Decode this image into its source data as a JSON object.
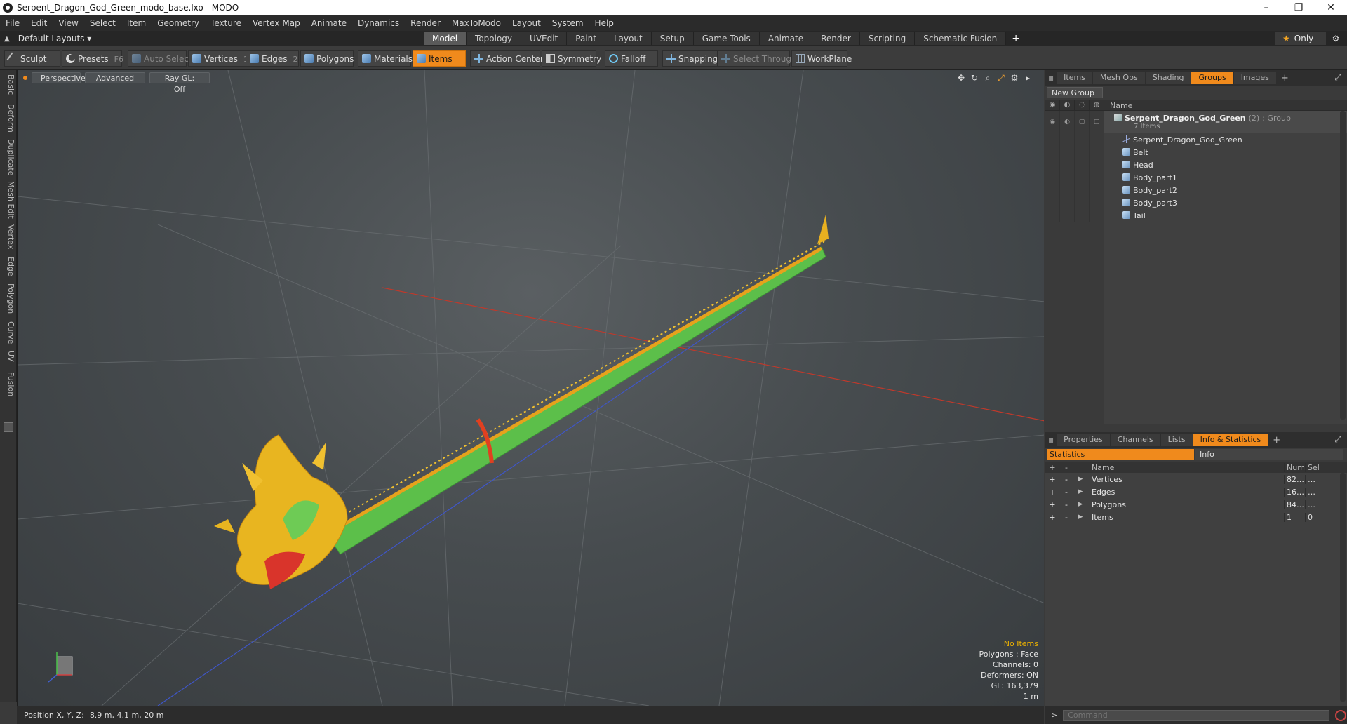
{
  "window": {
    "title": "Serpent_Dragon_God_Green_modo_base.lxo - MODO",
    "minimize": "–",
    "maximize": "❐",
    "close": "✕"
  },
  "menu": [
    "File",
    "Edit",
    "View",
    "Select",
    "Item",
    "Geometry",
    "Texture",
    "Vertex Map",
    "Animate",
    "Dynamics",
    "Render",
    "MaxToModo",
    "Layout",
    "System",
    "Help"
  ],
  "layout_bar": {
    "layout_label": "Default Layouts ▾",
    "tabs": [
      "Model",
      "Topology",
      "UVEdit",
      "Paint",
      "Layout",
      "Setup",
      "Game Tools",
      "Animate",
      "Render",
      "Scripting",
      "Schematic Fusion"
    ],
    "active_tab": "Model",
    "add": "+",
    "only": "Only"
  },
  "toolbar": {
    "sculpt": "Sculpt",
    "presets": "Presets",
    "presets_key": "F6",
    "auto_select": "Auto Select",
    "vertices": "Vertices",
    "vertices_count": "1",
    "edges": "Edges",
    "edges_count": "2",
    "polygons": "Polygons",
    "materials": "Materials",
    "items": "Items",
    "action_center": "Action Center",
    "symmetry": "Symmetry",
    "falloff": "Falloff",
    "snapping": "Snapping",
    "select_through": "Select Through",
    "workplane": "WorkPlane"
  },
  "left_tabs": [
    "Basic",
    "Deform",
    "Duplicate",
    "Mesh Edit",
    "Vertex",
    "Edge",
    "Polygon",
    "Curve",
    "UV",
    "Fusion"
  ],
  "viewport": {
    "perspective": "Perspective",
    "advanced": "Advanced",
    "raygl": "Ray GL: Off",
    "info": {
      "no_items": "No Items",
      "polygons": "Polygons : Face",
      "channels": "Channels: 0",
      "deformers": "Deformers: ON",
      "gl": "GL: 163,379",
      "scale": "1 m"
    }
  },
  "status": {
    "label": "Position X, Y, Z:",
    "value": "8.9 m, 4.1 m, 20 m"
  },
  "groups_panel": {
    "tabs": [
      "Items",
      "Mesh Ops",
      "Shading",
      "Groups",
      "Images"
    ],
    "active_tab": "Groups",
    "new_group": "New Group",
    "name_header": "Name",
    "group": {
      "name": "Serpent_Dragon_God_Green",
      "count": "(2)",
      "type": ": Group",
      "items_note": "7 Items"
    },
    "children": [
      "Serpent_Dragon_God_Green",
      "Belt",
      "Head",
      "Body_part1",
      "Body_part2",
      "Body_part3",
      "Tail"
    ]
  },
  "stats_panel": {
    "tabs": [
      "Properties",
      "Channels",
      "Lists",
      "Info & Statistics"
    ],
    "active_tab": "Info & Statistics",
    "sub_tabs": [
      "Statistics",
      "Info"
    ],
    "headers": {
      "name": "Name",
      "num": "Num",
      "sel": "Sel"
    },
    "rows": [
      {
        "name": "Vertices",
        "num": "82…",
        "sel": "…"
      },
      {
        "name": "Edges",
        "num": "16…",
        "sel": "…"
      },
      {
        "name": "Polygons",
        "num": "84…",
        "sel": "…"
      },
      {
        "name": "Items",
        "num": "1",
        "sel": "0"
      }
    ]
  },
  "command": {
    "prompt": ">",
    "placeholder": "Command"
  }
}
